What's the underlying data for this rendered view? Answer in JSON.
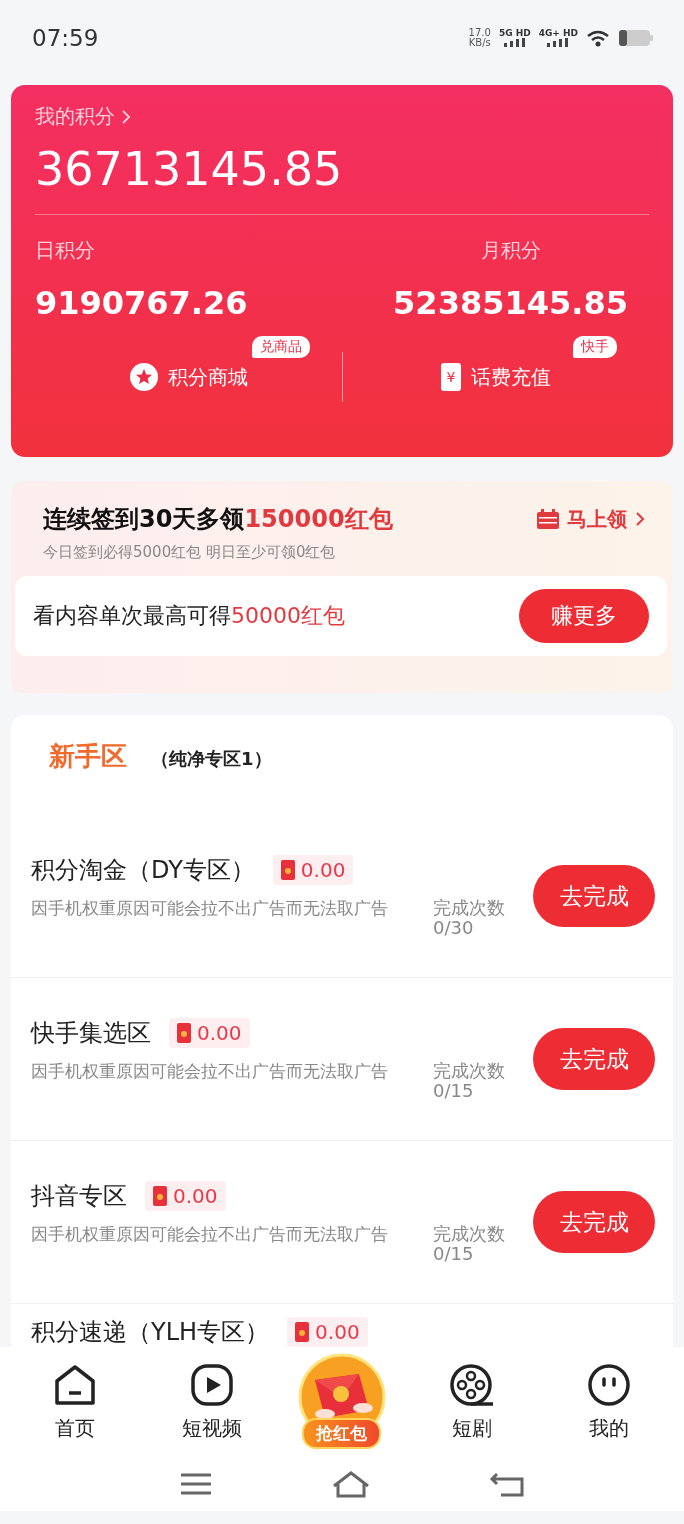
{
  "status_bar": {
    "time": "07:59",
    "speed": "17.0",
    "speed_unit": "KB/s",
    "sim1": "5G HD",
    "sim2": "4G+ HD"
  },
  "points_card": {
    "title": "我的积分",
    "total": "36713145.85",
    "daily_label": "日积分",
    "daily_value": "9190767.26",
    "monthly_label": "月积分",
    "monthly_value": "52385145.85",
    "shortcuts": [
      {
        "kind": "mall",
        "label": "积分商城",
        "badge": "兑商品"
      },
      {
        "kind": "phone",
        "icon_glyph": "¥",
        "label": "话费充值",
        "badge": "快手"
      }
    ]
  },
  "signin": {
    "headline": "连续签到30天多领",
    "headline_highlight": "150000红包",
    "claim_link": "马上领",
    "subtitle": "今日签到必得5000红包 明日至少可领0红包",
    "promo_text": "看内容单次最高可得",
    "promo_highlight": "50000红包",
    "promo_button": "赚更多"
  },
  "section": {
    "title": "新手区",
    "subtitle": "（纯净专区1）"
  },
  "tasks": [
    {
      "title": "积分淘金（DY专区）",
      "reward": "0.00",
      "note": "因手机权重原因可能会拉不出广告而无法取广告",
      "count_label": "完成次数",
      "count": "0/30",
      "button": "去完成"
    },
    {
      "title": "快手集选区",
      "reward": "0.00",
      "note": "因手机权重原因可能会拉不出广告而无法取广告",
      "count_label": "完成次数",
      "count": "0/15",
      "button": "去完成"
    },
    {
      "title": "抖音专区",
      "reward": "0.00",
      "note": "因手机权重原因可能会拉不出广告而无法取广告",
      "count_label": "完成次数",
      "count": "0/15",
      "button": "去完成"
    },
    {
      "title": "积分速递（YLH专区）",
      "reward": "0.00"
    }
  ],
  "bottom_nav": [
    {
      "kind": "home",
      "label": "首页"
    },
    {
      "kind": "video",
      "label": "短视频"
    },
    {
      "kind": "grab",
      "label": "抢红包"
    },
    {
      "kind": "drama",
      "label": "短剧"
    },
    {
      "kind": "profile",
      "label": "我的"
    }
  ]
}
